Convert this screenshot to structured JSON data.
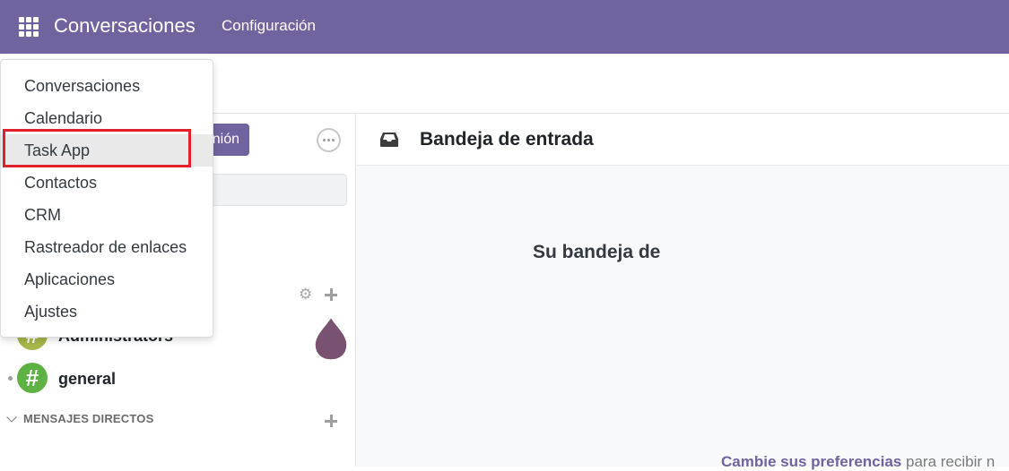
{
  "topbar": {
    "app_title": "Conversaciones",
    "menu_config": "Configuración",
    "background": "#71639e"
  },
  "sidebar": {
    "meeting_button_label": "nión",
    "channels": [
      {
        "name": "Administrators",
        "color": "#a8b64b"
      },
      {
        "name": "general",
        "color": "#5eb244"
      }
    ],
    "direct_messages_header": "MENSAJES DIRECTOS"
  },
  "main": {
    "title": "Bandeja de entrada",
    "empty_title": "Su bandeja de",
    "empty_link": "Cambie sus preferencias",
    "empty_text": "para recibir n"
  },
  "dropdown": {
    "items": [
      {
        "label": "Conversaciones"
      },
      {
        "label": "Calendario"
      },
      {
        "label": "Task App"
      },
      {
        "label": "Contactos"
      },
      {
        "label": "CRM"
      },
      {
        "label": "Rastreador de enlaces"
      },
      {
        "label": "Aplicaciones"
      },
      {
        "label": "Ajustes"
      }
    ],
    "highlighted": "Task App",
    "highlight_color": "#e0202a"
  }
}
